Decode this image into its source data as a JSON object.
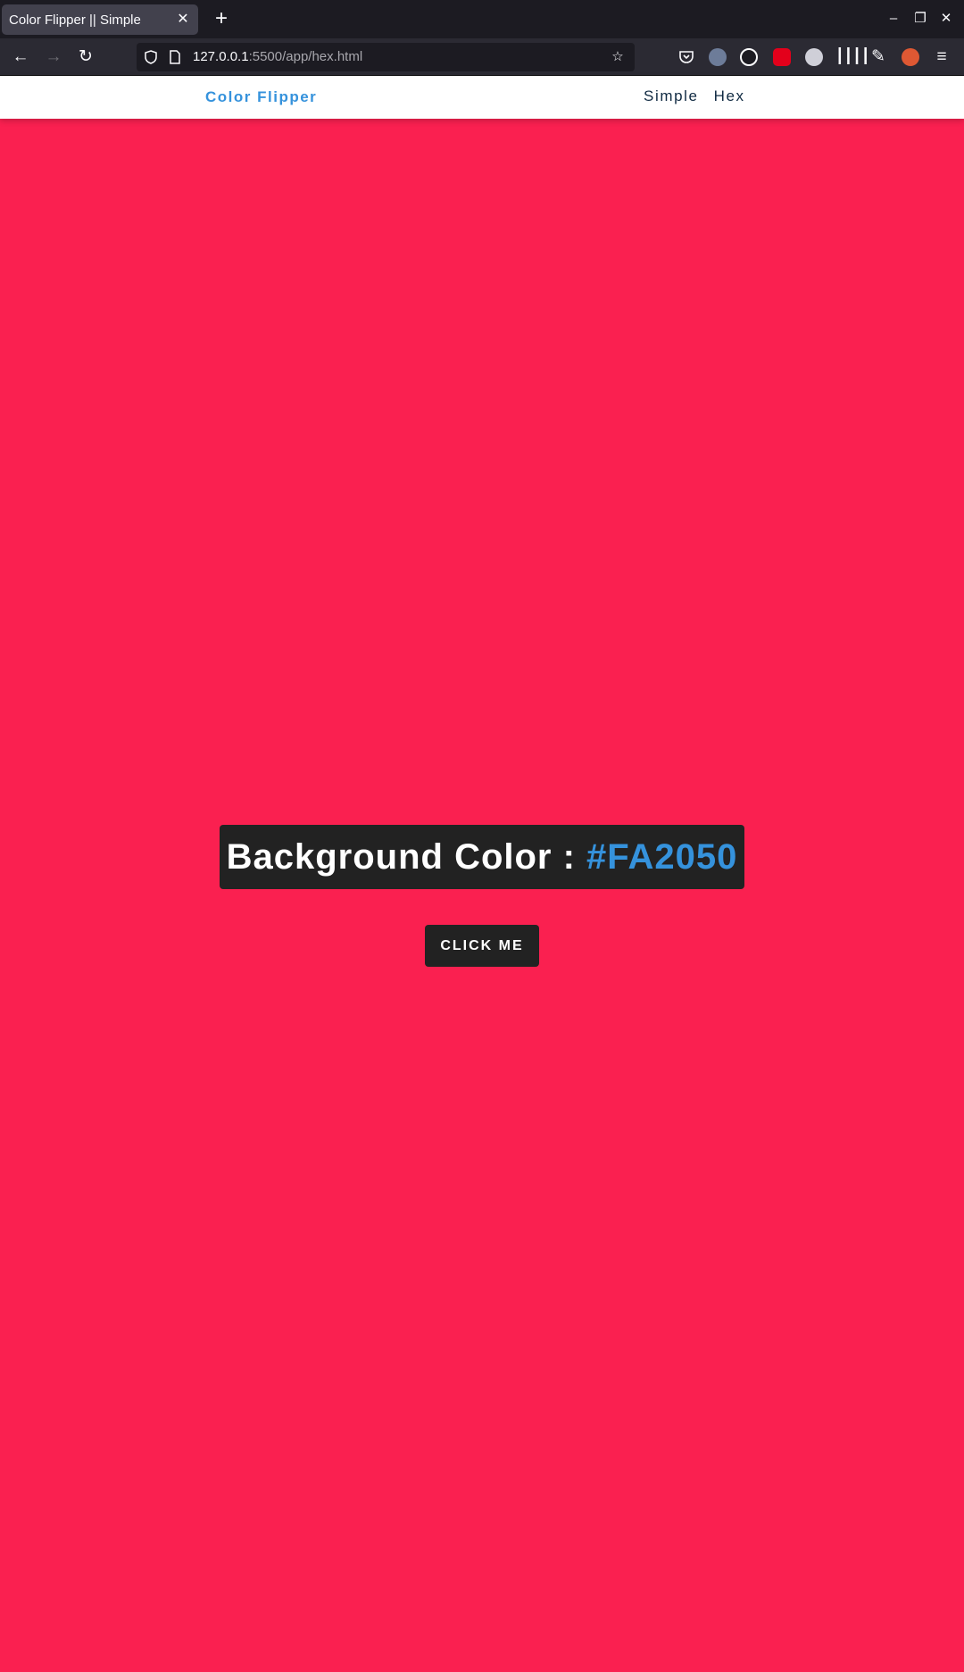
{
  "browser": {
    "tab_title": "Color Flipper || Simple",
    "tab_close": "✕",
    "new_tab": "+",
    "url_host": "127.0.0.1",
    "url_rest": ":5500/app/hex.html",
    "window_controls": {
      "minimize": "–",
      "restore": "❐",
      "close": "✕"
    }
  },
  "site": {
    "logo": "Color Flipper",
    "nav_links": [
      "Simple",
      "Hex"
    ]
  },
  "main": {
    "heading_label": "Background Color : ",
    "hex_value": "#FA2050",
    "button_label": "CLICK ME"
  },
  "colors": {
    "page_background": "#FA2050",
    "accent": "#3592dc",
    "dark_box": "#222222"
  }
}
